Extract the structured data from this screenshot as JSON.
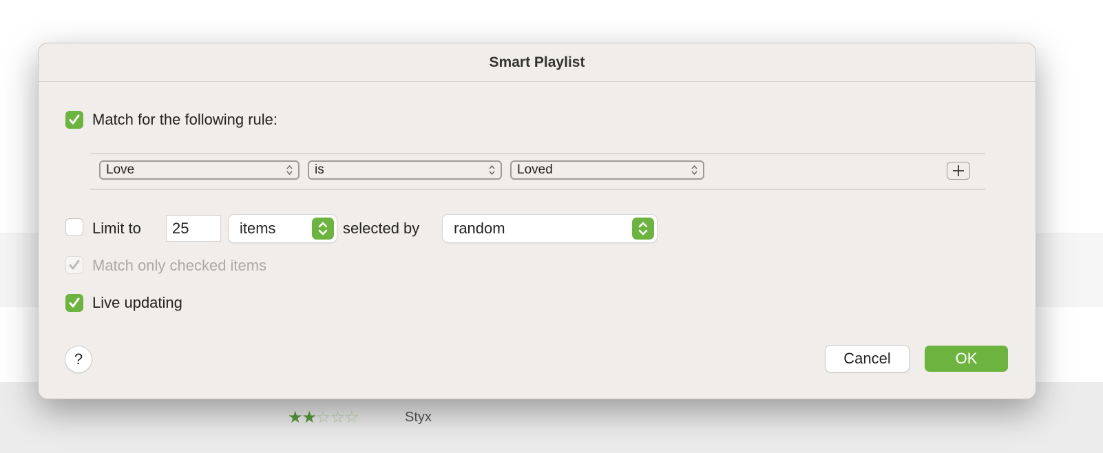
{
  "dialog": {
    "title": "Smart Playlist",
    "match_rule": {
      "label": "Match for the following rule:",
      "checked": true
    },
    "rule": {
      "field": "Love",
      "operator": "is",
      "value": "Loved",
      "add_icon": "plus-icon"
    },
    "limit": {
      "label": "Limit to",
      "checked": false,
      "count": "25",
      "unit": "items",
      "selected_by_label": "selected by",
      "selected_by": "random"
    },
    "match_checked": {
      "label": "Match only checked items",
      "checked": true,
      "disabled": true
    },
    "live_updating": {
      "label": "Live updating",
      "checked": true
    },
    "help_label": "?",
    "cancel_label": "Cancel",
    "ok_label": "OK"
  },
  "background": {
    "rating": 2,
    "rating_max": 5,
    "artist": "Styx"
  },
  "colors": {
    "accent": "#6db33f",
    "dialog_bg": "#f0edea"
  }
}
